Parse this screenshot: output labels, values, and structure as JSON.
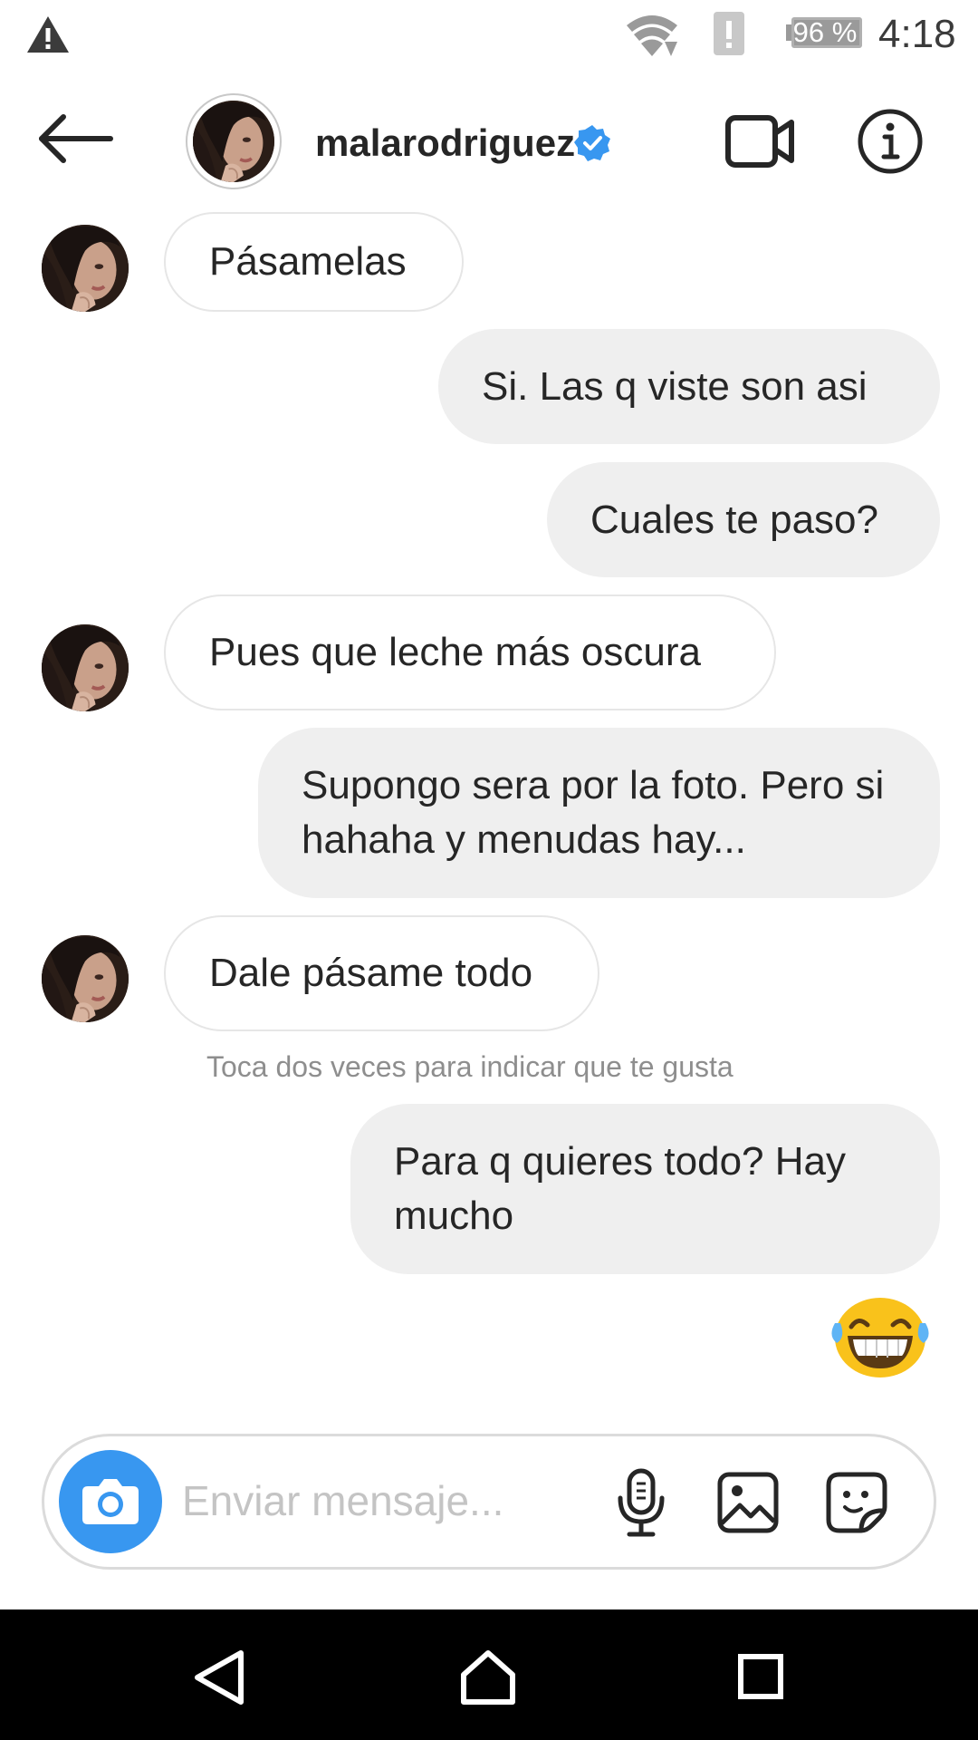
{
  "status_bar": {
    "time": "4:18",
    "battery": "96 %",
    "icons": [
      "warning-icon",
      "wifi-icon",
      "alert-icon",
      "battery-icon"
    ]
  },
  "header": {
    "username": "malarodriguez",
    "verified": true,
    "icons": [
      "back-arrow-icon",
      "video-call-icon",
      "info-icon",
      "verified-badge-icon"
    ]
  },
  "messages": [
    {
      "from": "them",
      "text": "Pásamelas"
    },
    {
      "from": "me",
      "text": "Si. Las q viste son asi"
    },
    {
      "from": "me",
      "text": "Cuales te paso?"
    },
    {
      "from": "them",
      "text": "Pues que leche más oscura"
    },
    {
      "from": "me",
      "text": "Supongo sera por la foto. Pero si hahaha y menudas hay..."
    },
    {
      "from": "them",
      "text": "Dale pásame todo"
    },
    {
      "from": "me",
      "text": "Para q quieres todo?  Hay mucho"
    },
    {
      "from": "me",
      "emoji": "tears-of-joy-emoji"
    }
  ],
  "hint": "Toca dos veces para indicar que te gusta",
  "composer": {
    "placeholder": "Enviar mensaje...",
    "icons": [
      "camera-icon",
      "microphone-icon",
      "gallery-icon",
      "sticker-icon"
    ]
  },
  "nav_bar": {
    "icons": [
      "nav-back-icon",
      "nav-home-icon",
      "nav-recents-icon"
    ]
  },
  "colors": {
    "accent": "#3897f0",
    "outgoing_bubble": "#efefef",
    "incoming_border": "#e6e6e6",
    "hint_text": "#8e8e8e"
  }
}
